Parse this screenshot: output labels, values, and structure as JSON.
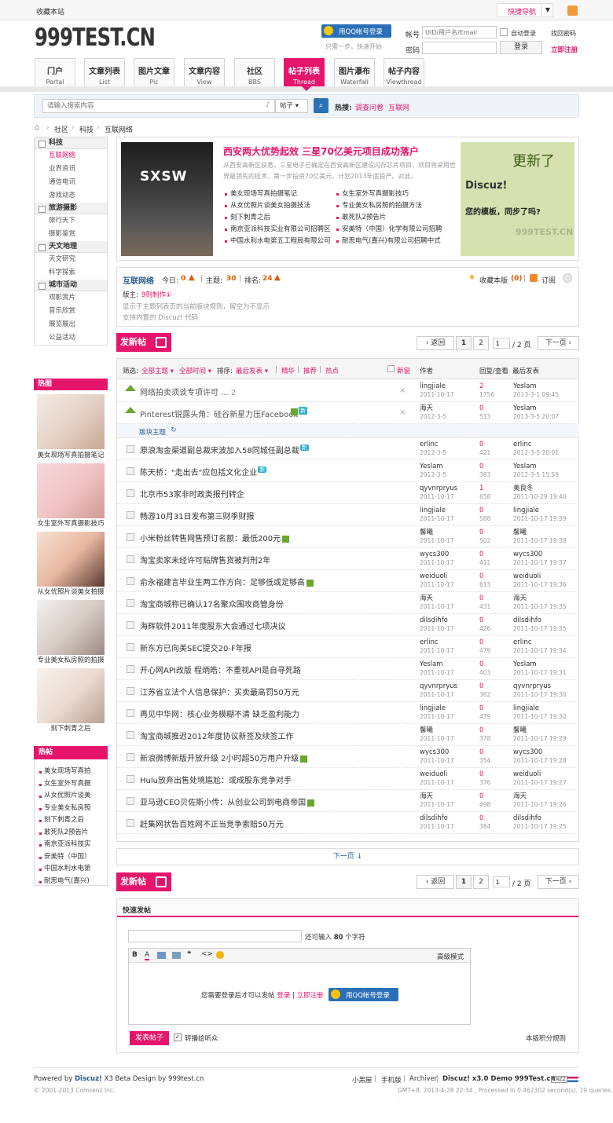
{
  "topbar": {
    "favorite": "收藏本站",
    "quicknav": "快捷导航"
  },
  "logo": "999TEST.CN",
  "qq": {
    "button": "用QQ帐号登录",
    "hint": "只需一步，快速开始"
  },
  "login": {
    "user_label": "帐号",
    "user_placeholder": "UID/用户名/Email",
    "auto": "自动登录",
    "forgot": "找回密码",
    "pass_label": "密码",
    "login_btn": "登录",
    "register": "立即注册"
  },
  "nav": [
    {
      "a": "门户",
      "b": "Portal"
    },
    {
      "a": "文章列表",
      "b": "List"
    },
    {
      "a": "图片文章",
      "b": "Pic"
    },
    {
      "a": "文章内容",
      "b": "View"
    },
    {
      "a": "社区",
      "b": "BBS"
    },
    {
      "a": "帖子列表",
      "b": "Thread"
    },
    {
      "a": "图片瀑布",
      "b": "Waterfall"
    },
    {
      "a": "帖子内容",
      "b": "Viewthread"
    }
  ],
  "search": {
    "placeholder": "请输入搜索内容",
    "type": "帖子",
    "hot_label": "热搜:",
    "hot1": "调查问卷",
    "hot2": "互联网"
  },
  "breadcrumb": [
    "社区",
    "科技",
    "互联网络"
  ],
  "sidebar": [
    {
      "head": "科技",
      "items": [
        "互联网络",
        "业界资讯",
        "通信电讯",
        "游戏动态"
      ]
    },
    {
      "head": "旅游摄影",
      "items": [
        "旅行天下",
        "摄影鉴赏"
      ]
    },
    {
      "head": "天文地理",
      "items": [
        "天文研究",
        "科学探索"
      ]
    },
    {
      "head": "城市活动",
      "items": [
        "观影赏片",
        "音乐欣赏",
        "展览展出",
        "公益活动"
      ]
    }
  ],
  "hotpic": {
    "title": "热图",
    "caps": [
      "美女现场写真拍摄笔记",
      "女生室外写真摄影技巧",
      "从女优照片谈美女拍摄",
      "专业美女私房照的拍摄",
      "刻下刺青之后"
    ]
  },
  "hotpost": {
    "title": "热帖",
    "items": [
      "美女现场写真拍",
      "女生室外写真摄",
      "从女优照片谈美",
      "专业美女私房照",
      "刻下刺青之后",
      "敢死队2预告片",
      "南京亚派科技实",
      "安美特（中国）",
      "中国水利水电第",
      "耐思电气(嘉兴)"
    ]
  },
  "feature": {
    "img_text": "SXSW",
    "headline": "西安两大优势起效 三星70亿美元项目成功落户",
    "desc": "从西安高新区获悉，三星电子已确定在西安高新区建设闪存芯片项目，项目将采用世界最领先的技术，第一步投资70亿美元，计划2013年底投产。对此，",
    "list": [
      "美女现场写真拍摄笔记",
      "女生室外写真摄影技巧",
      "从女优照片谈美女拍摄技法",
      "专业美女私房照的拍摄方法",
      "刻下刺青之后",
      "敢死队2预告片",
      "南京亚派科技实业有限公司招聘区",
      "安美特（中国）化学有限公司招聘",
      "中国水利水电第五工程局有限公司",
      "耐思电气(嘉兴)有限公司招聘中式"
    ],
    "ad1": "更新了",
    "ad2": "Discuz!",
    "ad3": "您的模板，同步了吗?",
    "ad4": "999TEST.CN"
  },
  "forum": {
    "name": "互联网络",
    "today_l": "今日:",
    "today": "0",
    "topics_l": "主题:",
    "topics": "30",
    "rank_l": "排名:",
    "rank": "24",
    "fav": "收藏本版",
    "fav_n": "(0)",
    "rss": "订阅",
    "mod_l": "版主:",
    "mod": "9则制作①",
    "rule": "显示于主题列表页的当前版块规则，留空为不显示",
    "code": "支持内置的 Discuz! 代码"
  },
  "pager": {
    "prev": "返回",
    "p1": "1",
    "p2": "2",
    "cur": "1",
    "total": "/ 2 页",
    "next": "下一页"
  },
  "newpost": "发新帖",
  "filter": {
    "label": "筛选:",
    "all": "全部主题",
    "time": "全部时间",
    "sort_l": "排序:",
    "sort": "最后发表",
    "digest": "精华",
    "rec": "推荐",
    "hot": "热点",
    "newwin": "新窗",
    "author": "作者",
    "reply": "回复/查看",
    "last": "最后发表"
  },
  "sticky": [
    {
      "t": "网络拍卖须谈专项许可 ...",
      "n": "2",
      "a": "lingjiale",
      "ad": "2011-10-17",
      "r": "2",
      "v": "1756",
      "l": "Yeslam",
      "ld": "2013-3-1 09:45"
    },
    {
      "t": "Pinterest锐露头角：硅谷新星力压Facebook",
      "a": "海天",
      "ad": "2012-3-5",
      "r": "0",
      "v": "513",
      "l": "Yeslam",
      "ld": "2013-3-5 20:07"
    }
  ],
  "sep": "版块主题",
  "threads": [
    {
      "t": "原浪淘金渠道副总裁宋波加入58同城任副总裁",
      "a": "erlinc",
      "ad": "2012-3-5",
      "r": "0",
      "v": "421",
      "l": "erlinc",
      "ld": "2012-3-5 20:01"
    },
    {
      "t": "陈天桥：\"走出去\"应包括文化企业",
      "a": "Yeslam",
      "ad": "2012-3-5",
      "r": "0",
      "v": "383",
      "l": "Yeslam",
      "ld": "2012-3-5 15:59"
    },
    {
      "t": "北京市53家非时政类报刊转企",
      "a": "qyvnrpryus",
      "ad": "2011-10-17",
      "r": "1",
      "v": "658",
      "l": "美良冬",
      "ld": "2011-10-29 19:40"
    },
    {
      "t": "畅游10月31日发布第三财季财报",
      "a": "lingjiale",
      "ad": "2011-10-17",
      "r": "0",
      "v": "588",
      "l": "lingjiale",
      "ld": "2011-10-17 19:39"
    },
    {
      "t": "小米粉丝转售网售预订名额：最低200元",
      "a": "馨曦",
      "ad": "2011-10-17",
      "r": "0",
      "v": "502",
      "l": "馨曦",
      "ld": "2011-10-17 19:38"
    },
    {
      "t": "淘宝卖家未经许可贴牌售货被判刑2年",
      "a": "wycs300",
      "ad": "2011-10-17",
      "r": "0",
      "v": "411",
      "l": "wycs300",
      "ld": "2011-10-17 19:37"
    },
    {
      "t": "俞永福建言毕业生两工作方向：足够低或足够高",
      "a": "weiduoli",
      "ad": "2011-10-17",
      "r": "0",
      "v": "613",
      "l": "weiduoli",
      "ld": "2011-10-17 19:36"
    },
    {
      "t": "淘宝商城称已确认17名聚众围攻商管身份",
      "a": "海天",
      "ad": "2011-10-17",
      "r": "0",
      "v": "431",
      "l": "海天",
      "ld": "2011-10-17 19:35"
    },
    {
      "t": "海辉软件2011年度股东大会通过七项决议",
      "a": "dilsdihfo",
      "ad": "2011-10-17",
      "r": "0",
      "v": "426",
      "l": "dilsdihfo",
      "ld": "2011-10-17 19:35"
    },
    {
      "t": "新东方已向美SEC提交20-F年报",
      "a": "erlinc",
      "ad": "2011-10-17",
      "r": "0",
      "v": "479",
      "l": "erlinc",
      "ld": "2011-10-17 19:34"
    },
    {
      "t": "开心网API改版 程炳皓：不重视API是自寻死路",
      "a": "Yeslam",
      "ad": "2011-10-17",
      "r": "0",
      "v": "403",
      "l": "Yeslam",
      "ld": "2011-10-17 19:31"
    },
    {
      "t": "江苏省立法个人信息保护：买卖最高罚50万元",
      "a": "qyvnrpryus",
      "ad": "2011-10-17",
      "r": "0",
      "v": "362",
      "l": "qyvnrpryus",
      "ld": "2011-10-17 19:30"
    },
    {
      "t": "再见中华网：核心业务模糊不清 缺乏盈利能力",
      "a": "lingjiale",
      "ad": "2011-10-17",
      "r": "0",
      "v": "439",
      "l": "lingjiale",
      "ld": "2011-10-17 19:30"
    },
    {
      "t": "淘宝商城推迟2012年度协议新签及续签工作",
      "a": "馨曦",
      "ad": "2011-10-17",
      "r": "0",
      "v": "378",
      "l": "馨曦",
      "ld": "2011-10-17 19:29"
    },
    {
      "t": "新浪微博新版开放升级 2小时超50万用户升级",
      "a": "wycs300",
      "ad": "2011-10-17",
      "r": "0",
      "v": "354",
      "l": "wycs300",
      "ld": "2011-10-17 19:28"
    },
    {
      "t": "Hulu放弃出售处境尴尬：或成股东竞争对手",
      "a": "weiduoli",
      "ad": "2011-10-17",
      "r": "0",
      "v": "376",
      "l": "weiduoli",
      "ld": "2011-10-17 19:27"
    },
    {
      "t": "亚马逊CEO贝佐斯小传：从创业公司到电商帝国",
      "a": "海天",
      "ad": "2011-10-17",
      "r": "0",
      "v": "498",
      "l": "海天",
      "ld": "2011-10-17 19:26"
    },
    {
      "t": "赶集网状告百姓网不正当竞争索赔50万元",
      "a": "dilsdihfo",
      "ad": "2011-10-17",
      "r": "0",
      "v": "384",
      "l": "dilsdihfo",
      "ld": "2011-10-17 19:25"
    }
  ],
  "nextpage": "下一页 ↓",
  "quick": {
    "title": "快速发帖",
    "counter_pre": "还可输入",
    "counter_n": "80",
    "counter_suf": "个字符",
    "adv": "高级模式",
    "tip": "您需要登录后才可以发帖",
    "login": "登录",
    "reg": "立即注册",
    "submit": "发表帖子",
    "sync": "转播给听众",
    "rules": "本版积分规则"
  },
  "footer": {
    "powered_pre": "Powered by",
    "discuz": "Discuz!",
    "powered_suf": "X3 Beta Design by",
    "site": "999test.cn",
    "copy": "© 2001-2013 Comsenz Inc.",
    "links": [
      "小黑屋",
      "手机版",
      "Archiver"
    ],
    "demo": "Discuz! x3.0 Demo 999Test.cn",
    "badge": "CNZZ",
    "gmt": "GMT+8, 2013-4-28 22:34 , Processed in 0.462302 second(s), 19 queries ."
  },
  "colors": {
    "accent": "#e5156c",
    "up": "#e05a00"
  }
}
